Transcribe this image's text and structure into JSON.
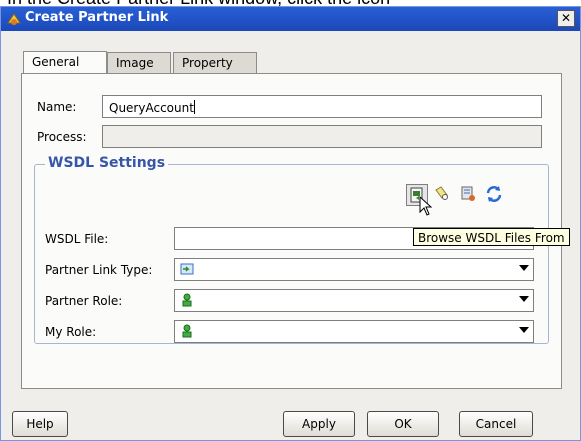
{
  "caption": "In the Create Partner Link window, click the icon",
  "window": {
    "title": "Create Partner Link",
    "close_glyph": "✕"
  },
  "tabs": [
    {
      "label": "General",
      "active": true
    },
    {
      "label": "Image",
      "active": false
    },
    {
      "label": "Property",
      "active": false
    }
  ],
  "form": {
    "name_label": "Name:",
    "name_value": "QueryAccount",
    "process_label": "Process:",
    "process_value": ""
  },
  "wsdl": {
    "group_title": "WSDL Settings",
    "wsdl_file_label": "WSDL File:",
    "wsdl_file_value": "",
    "partner_link_type_label": "Partner Link Type:",
    "partner_role_label": "Partner Role:",
    "my_role_label": "My Role:",
    "toolbar_icons": [
      "browse-wsdl-icon",
      "flashlight-icon",
      "service-explorer-icon",
      "refresh-icon"
    ]
  },
  "tooltip": "Browse WSDL Files From",
  "buttons": {
    "help": "Help",
    "apply": "Apply",
    "ok": "OK",
    "cancel": "Cancel"
  },
  "colors": {
    "titlebar": "#2860d6",
    "group_title": "#3856a8",
    "tooltip_bg": "#ffffe1",
    "dialog_bg": "#efeeea"
  }
}
